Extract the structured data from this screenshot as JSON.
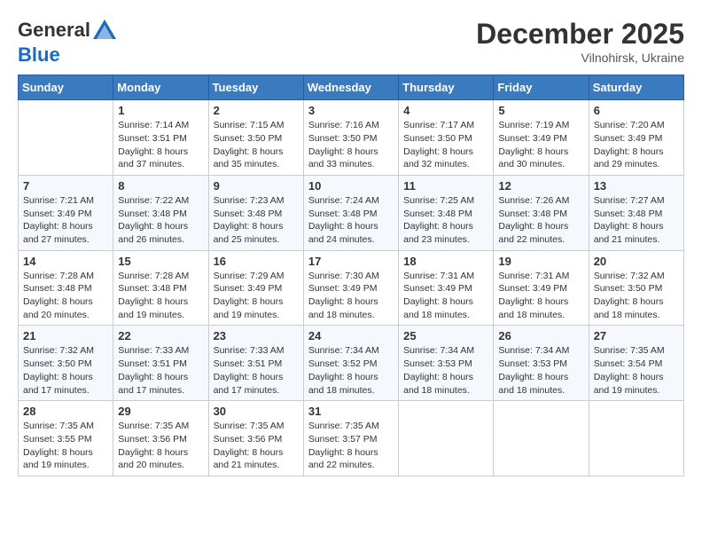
{
  "header": {
    "logo_line1": "General",
    "logo_line2": "Blue",
    "month_year": "December 2025",
    "location": "Vilnohirsk, Ukraine"
  },
  "weekdays": [
    "Sunday",
    "Monday",
    "Tuesday",
    "Wednesday",
    "Thursday",
    "Friday",
    "Saturday"
  ],
  "weeks": [
    [
      {
        "day": "",
        "sunrise": "",
        "sunset": "",
        "daylight": ""
      },
      {
        "day": "1",
        "sunrise": "Sunrise: 7:14 AM",
        "sunset": "Sunset: 3:51 PM",
        "daylight": "Daylight: 8 hours and 37 minutes."
      },
      {
        "day": "2",
        "sunrise": "Sunrise: 7:15 AM",
        "sunset": "Sunset: 3:50 PM",
        "daylight": "Daylight: 8 hours and 35 minutes."
      },
      {
        "day": "3",
        "sunrise": "Sunrise: 7:16 AM",
        "sunset": "Sunset: 3:50 PM",
        "daylight": "Daylight: 8 hours and 33 minutes."
      },
      {
        "day": "4",
        "sunrise": "Sunrise: 7:17 AM",
        "sunset": "Sunset: 3:50 PM",
        "daylight": "Daylight: 8 hours and 32 minutes."
      },
      {
        "day": "5",
        "sunrise": "Sunrise: 7:19 AM",
        "sunset": "Sunset: 3:49 PM",
        "daylight": "Daylight: 8 hours and 30 minutes."
      },
      {
        "day": "6",
        "sunrise": "Sunrise: 7:20 AM",
        "sunset": "Sunset: 3:49 PM",
        "daylight": "Daylight: 8 hours and 29 minutes."
      }
    ],
    [
      {
        "day": "7",
        "sunrise": "Sunrise: 7:21 AM",
        "sunset": "Sunset: 3:49 PM",
        "daylight": "Daylight: 8 hours and 27 minutes."
      },
      {
        "day": "8",
        "sunrise": "Sunrise: 7:22 AM",
        "sunset": "Sunset: 3:48 PM",
        "daylight": "Daylight: 8 hours and 26 minutes."
      },
      {
        "day": "9",
        "sunrise": "Sunrise: 7:23 AM",
        "sunset": "Sunset: 3:48 PM",
        "daylight": "Daylight: 8 hours and 25 minutes."
      },
      {
        "day": "10",
        "sunrise": "Sunrise: 7:24 AM",
        "sunset": "Sunset: 3:48 PM",
        "daylight": "Daylight: 8 hours and 24 minutes."
      },
      {
        "day": "11",
        "sunrise": "Sunrise: 7:25 AM",
        "sunset": "Sunset: 3:48 PM",
        "daylight": "Daylight: 8 hours and 23 minutes."
      },
      {
        "day": "12",
        "sunrise": "Sunrise: 7:26 AM",
        "sunset": "Sunset: 3:48 PM",
        "daylight": "Daylight: 8 hours and 22 minutes."
      },
      {
        "day": "13",
        "sunrise": "Sunrise: 7:27 AM",
        "sunset": "Sunset: 3:48 PM",
        "daylight": "Daylight: 8 hours and 21 minutes."
      }
    ],
    [
      {
        "day": "14",
        "sunrise": "Sunrise: 7:28 AM",
        "sunset": "Sunset: 3:48 PM",
        "daylight": "Daylight: 8 hours and 20 minutes."
      },
      {
        "day": "15",
        "sunrise": "Sunrise: 7:28 AM",
        "sunset": "Sunset: 3:48 PM",
        "daylight": "Daylight: 8 hours and 19 minutes."
      },
      {
        "day": "16",
        "sunrise": "Sunrise: 7:29 AM",
        "sunset": "Sunset: 3:49 PM",
        "daylight": "Daylight: 8 hours and 19 minutes."
      },
      {
        "day": "17",
        "sunrise": "Sunrise: 7:30 AM",
        "sunset": "Sunset: 3:49 PM",
        "daylight": "Daylight: 8 hours and 18 minutes."
      },
      {
        "day": "18",
        "sunrise": "Sunrise: 7:31 AM",
        "sunset": "Sunset: 3:49 PM",
        "daylight": "Daylight: 8 hours and 18 minutes."
      },
      {
        "day": "19",
        "sunrise": "Sunrise: 7:31 AM",
        "sunset": "Sunset: 3:49 PM",
        "daylight": "Daylight: 8 hours and 18 minutes."
      },
      {
        "day": "20",
        "sunrise": "Sunrise: 7:32 AM",
        "sunset": "Sunset: 3:50 PM",
        "daylight": "Daylight: 8 hours and 18 minutes."
      }
    ],
    [
      {
        "day": "21",
        "sunrise": "Sunrise: 7:32 AM",
        "sunset": "Sunset: 3:50 PM",
        "daylight": "Daylight: 8 hours and 17 minutes."
      },
      {
        "day": "22",
        "sunrise": "Sunrise: 7:33 AM",
        "sunset": "Sunset: 3:51 PM",
        "daylight": "Daylight: 8 hours and 17 minutes."
      },
      {
        "day": "23",
        "sunrise": "Sunrise: 7:33 AM",
        "sunset": "Sunset: 3:51 PM",
        "daylight": "Daylight: 8 hours and 17 minutes."
      },
      {
        "day": "24",
        "sunrise": "Sunrise: 7:34 AM",
        "sunset": "Sunset: 3:52 PM",
        "daylight": "Daylight: 8 hours and 18 minutes."
      },
      {
        "day": "25",
        "sunrise": "Sunrise: 7:34 AM",
        "sunset": "Sunset: 3:53 PM",
        "daylight": "Daylight: 8 hours and 18 minutes."
      },
      {
        "day": "26",
        "sunrise": "Sunrise: 7:34 AM",
        "sunset": "Sunset: 3:53 PM",
        "daylight": "Daylight: 8 hours and 18 minutes."
      },
      {
        "day": "27",
        "sunrise": "Sunrise: 7:35 AM",
        "sunset": "Sunset: 3:54 PM",
        "daylight": "Daylight: 8 hours and 19 minutes."
      }
    ],
    [
      {
        "day": "28",
        "sunrise": "Sunrise: 7:35 AM",
        "sunset": "Sunset: 3:55 PM",
        "daylight": "Daylight: 8 hours and 19 minutes."
      },
      {
        "day": "29",
        "sunrise": "Sunrise: 7:35 AM",
        "sunset": "Sunset: 3:56 PM",
        "daylight": "Daylight: 8 hours and 20 minutes."
      },
      {
        "day": "30",
        "sunrise": "Sunrise: 7:35 AM",
        "sunset": "Sunset: 3:56 PM",
        "daylight": "Daylight: 8 hours and 21 minutes."
      },
      {
        "day": "31",
        "sunrise": "Sunrise: 7:35 AM",
        "sunset": "Sunset: 3:57 PM",
        "daylight": "Daylight: 8 hours and 22 minutes."
      },
      {
        "day": "",
        "sunrise": "",
        "sunset": "",
        "daylight": ""
      },
      {
        "day": "",
        "sunrise": "",
        "sunset": "",
        "daylight": ""
      },
      {
        "day": "",
        "sunrise": "",
        "sunset": "",
        "daylight": ""
      }
    ]
  ]
}
